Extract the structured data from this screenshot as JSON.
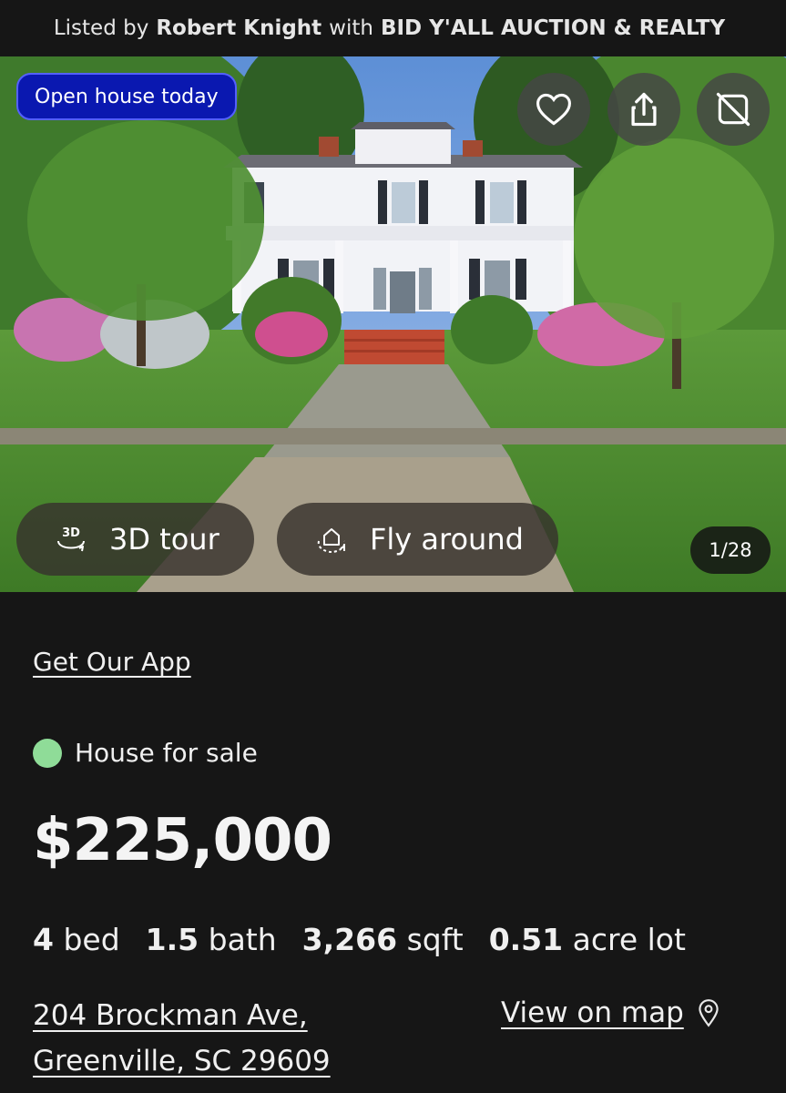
{
  "listing_bar": {
    "prefix": "Listed by",
    "agent": "Robert Knight",
    "with": "with",
    "brokerage": "BID Y'ALL AUCTION & REALTY"
  },
  "hero": {
    "badge": "Open house today",
    "icons": [
      "heart-icon",
      "share-icon",
      "no-photos-icon"
    ],
    "tour_button": "3D tour",
    "fly_button": "Fly around",
    "photo_counter": "1/28"
  },
  "get_app": "Get Our App",
  "status": {
    "label": "House for sale",
    "color": "#8fdc98"
  },
  "price": "$225,000",
  "facts": [
    {
      "value": "4",
      "unit": "bed"
    },
    {
      "value": "1.5",
      "unit": "bath"
    },
    {
      "value": "3,266",
      "unit": "sqft"
    },
    {
      "value": "0.51",
      "unit": "acre lot"
    }
  ],
  "address": {
    "line1": "204 Brockman Ave,",
    "line2": "Greenville, SC 29609"
  },
  "map_link": "View on map",
  "colors": {
    "background": "#161616",
    "badge": "#0a18b0",
    "accent_dot": "#8fdc98"
  }
}
